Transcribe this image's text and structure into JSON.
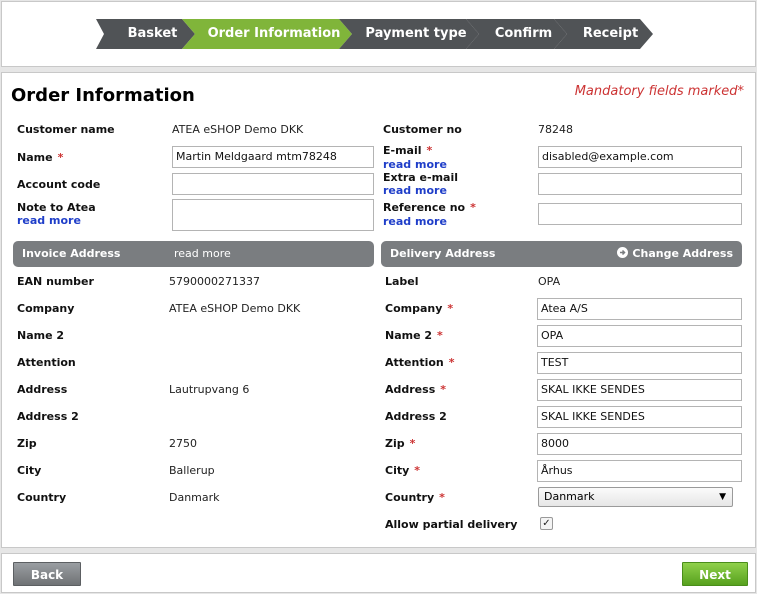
{
  "steps": [
    "Basket",
    "Order Information",
    "Payment type",
    "Confirm",
    "Receipt"
  ],
  "page_title": "Order Information",
  "mandatory_note": "Mandatory fields marked*",
  "required_mark": "*",
  "read_more": "read more",
  "customer": {
    "customer_name_label": "Customer name",
    "customer_name_value": "ATEA eSHOP Demo DKK",
    "customer_no_label": "Customer no",
    "customer_no_value": "78248",
    "name_label": "Name",
    "name_value": "Martin Meldgaard mtm78248",
    "email_label": "E-mail",
    "email_value": "disabled@example.com",
    "account_code_label": "Account code",
    "account_code_value": "",
    "extra_email_label": "Extra e-mail",
    "extra_email_value": "",
    "note_label": "Note to Atea",
    "note_value": "",
    "reference_label": "Reference no",
    "reference_value": ""
  },
  "invoice": {
    "title": "Invoice Address",
    "read_more": "read more",
    "rows": [
      {
        "label": "EAN number",
        "value": "5790000271337"
      },
      {
        "label": "Company",
        "value": "ATEA eSHOP Demo DKK"
      },
      {
        "label": "Name 2",
        "value": ""
      },
      {
        "label": "Attention",
        "value": ""
      },
      {
        "label": "Address",
        "value": "Lautrupvang 6"
      },
      {
        "label": "Address 2",
        "value": ""
      },
      {
        "label": "Zip",
        "value": "2750"
      },
      {
        "label": "City",
        "value": "Ballerup"
      },
      {
        "label": "Country",
        "value": "Danmark"
      }
    ]
  },
  "delivery": {
    "title": "Delivery Address",
    "change_label": "Change Address",
    "label_label": "Label",
    "label_value": "OPA",
    "company_label": "Company",
    "company_value": "Atea A/S",
    "name2_label": "Name 2",
    "name2_value": "OPA",
    "attention_label": "Attention",
    "attention_value": "TEST",
    "address_label": "Address",
    "address_value": "SKAL IKKE SENDES",
    "address2_label": "Address 2",
    "address2_value": "SKAL IKKE SENDES",
    "zip_label": "Zip",
    "zip_value": "8000",
    "city_label": "City",
    "city_value": "Århus",
    "country_label": "Country",
    "country_value": "Danmark",
    "partial_label": "Allow partial delivery",
    "partial_checked": true
  },
  "footer": {
    "back_label": "Back",
    "next_label": "Next"
  }
}
